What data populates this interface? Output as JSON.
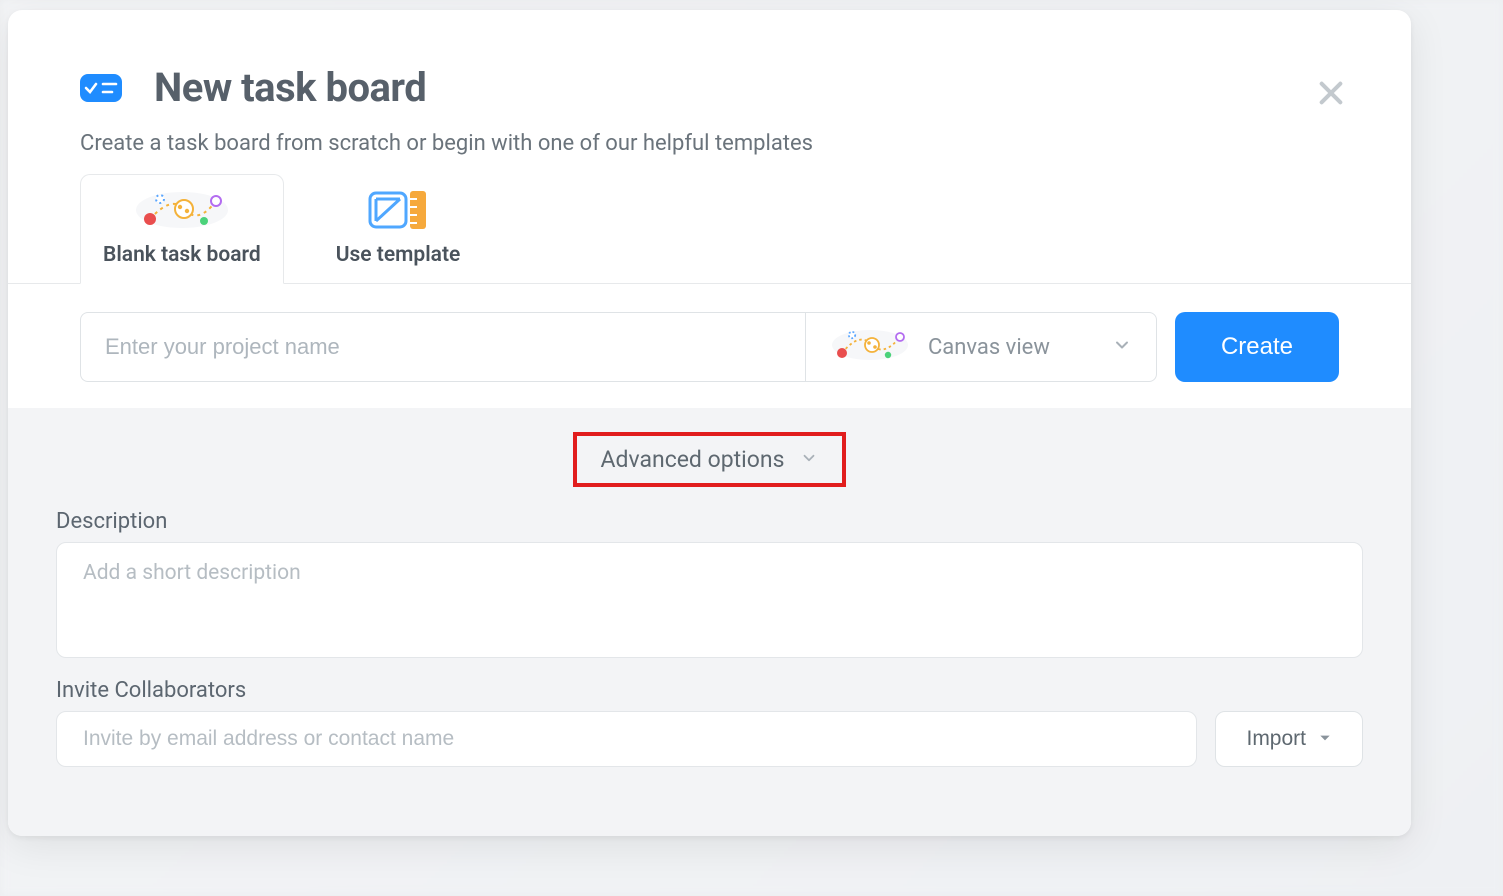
{
  "dialog": {
    "title": "New task board",
    "subtitle": "Create a task board from scratch or begin with one of our helpful templates",
    "tabs": {
      "blank": "Blank task board",
      "template": "Use template"
    },
    "project_name_placeholder": "Enter your project name",
    "view_select": {
      "label": "Canvas view"
    },
    "create_label": "Create",
    "advanced": {
      "label": "Advanced options"
    },
    "description": {
      "heading": "Description",
      "placeholder": "Add a short description"
    },
    "invite": {
      "heading": "Invite Collaborators",
      "placeholder": "Invite by email address or contact name",
      "import_label": "Import"
    },
    "icons": {
      "brand": "task-badge-icon",
      "close": "close-icon",
      "blank_tab": "network-graph-icon",
      "template_tab": "template-ruler-icon",
      "canvas": "canvas-view-icon",
      "chevron": "chevron-down-icon",
      "caret": "caret-down-icon"
    },
    "colors": {
      "primary": "#1f8cff",
      "highlight": "#e11d1d"
    }
  }
}
